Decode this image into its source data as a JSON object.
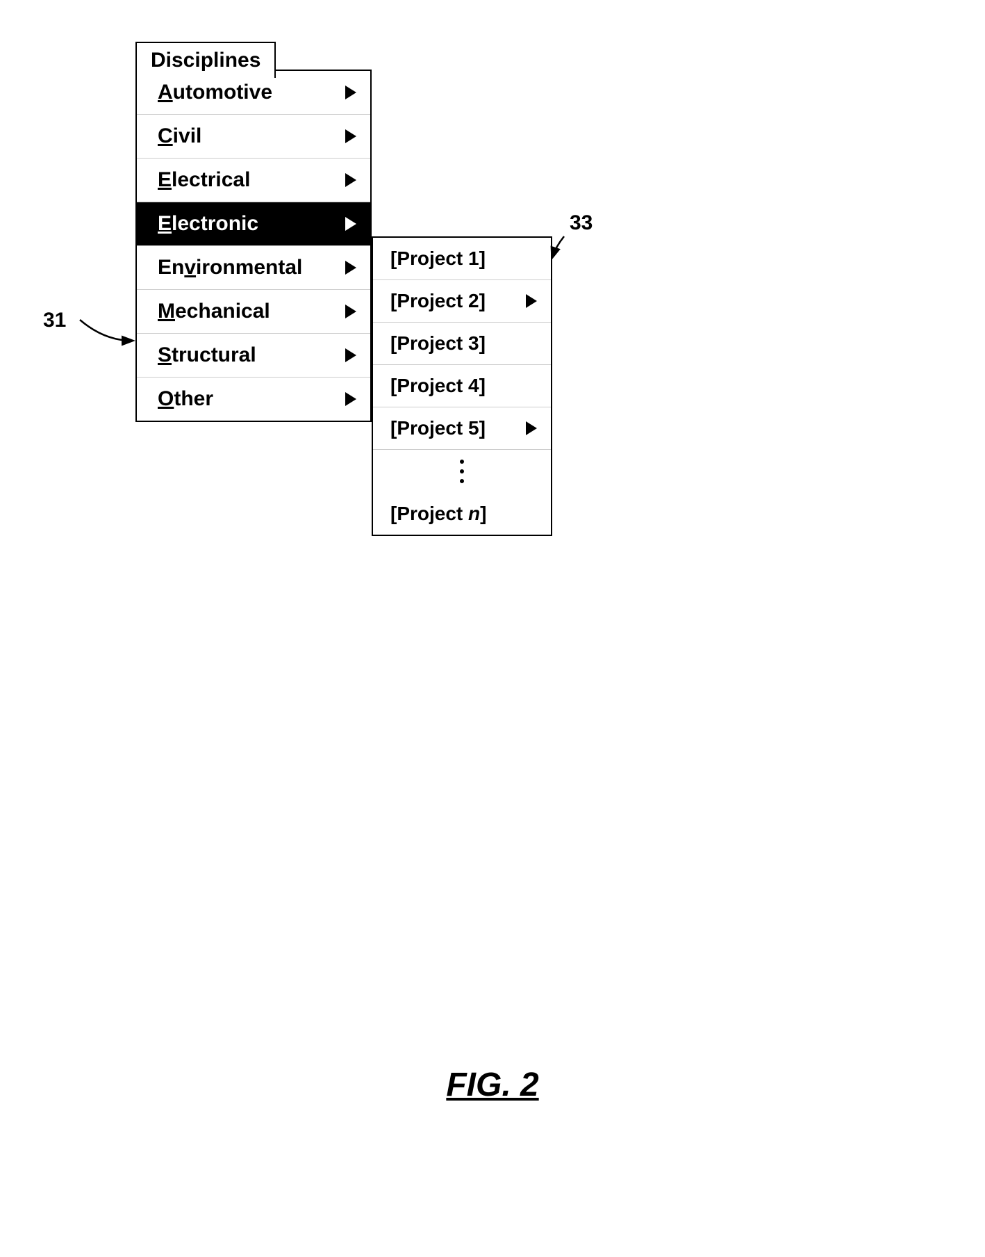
{
  "header": {
    "disciplines_label": "Disciplines"
  },
  "disciplines_menu": {
    "items": [
      {
        "label": "Automotive",
        "underline_index": 0,
        "has_arrow": true,
        "highlighted": false
      },
      {
        "label": "Civil",
        "underline_index": 0,
        "has_arrow": true,
        "highlighted": false
      },
      {
        "label": "Electrical",
        "underline_index": 0,
        "has_arrow": true,
        "highlighted": false
      },
      {
        "label": "Electronic",
        "underline_index": 0,
        "has_arrow": true,
        "highlighted": true
      },
      {
        "label": "Environmental",
        "underline_index": 2,
        "has_arrow": true,
        "highlighted": false
      },
      {
        "label": "Mechanical",
        "underline_index": 0,
        "has_arrow": true,
        "highlighted": false
      },
      {
        "label": "Structural",
        "underline_index": 0,
        "has_arrow": true,
        "highlighted": false
      },
      {
        "label": "Other",
        "underline_index": 0,
        "has_arrow": true,
        "highlighted": false
      }
    ]
  },
  "projects_menu": {
    "items": [
      {
        "label": "[Project 1]",
        "has_arrow": false
      },
      {
        "label": "[Project 2]",
        "has_arrow": true
      },
      {
        "label": "[Project 3]",
        "has_arrow": false
      },
      {
        "label": "[Project 4]",
        "has_arrow": false
      },
      {
        "label": "[Project 5]",
        "has_arrow": true
      }
    ],
    "last_item": "[Project n]"
  },
  "annotations": {
    "label_31": "31",
    "label_33": "33"
  },
  "figure": {
    "caption": "FIG. 2"
  }
}
